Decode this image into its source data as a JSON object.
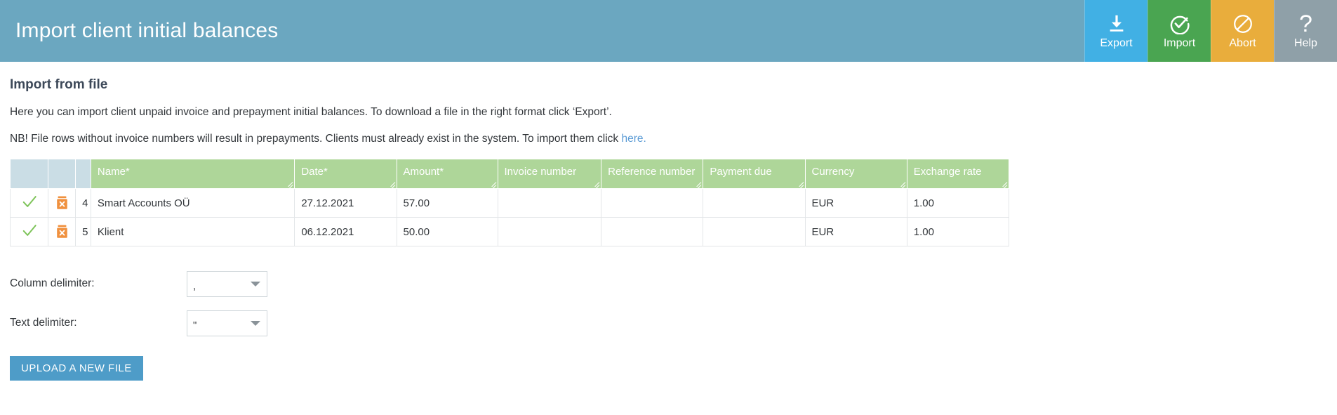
{
  "header": {
    "title": "Import client initial balances",
    "actions": [
      {
        "label": "Export",
        "icon": "download-icon",
        "color": "#41b0e4"
      },
      {
        "label": "Import",
        "icon": "check-circle-icon",
        "color": "#4aa551"
      },
      {
        "label": "Abort",
        "icon": "no-entry-icon",
        "color": "#e9ad3c"
      },
      {
        "label": "Help",
        "icon": "question-mark-icon",
        "color": "#8fa0a8"
      }
    ]
  },
  "main": {
    "section_title": "Import from file",
    "intro": "Here you can import client unpaid invoice and prepayment initial balances. To download a file in the right format click ‘Export’.",
    "note_before_link": "NB! File rows without invoice numbers will result in prepayments. Clients must already exist in the system. To import them click ",
    "note_link": "here.",
    "link_color": "#5b9bd5"
  },
  "table": {
    "header_bg": "#aed699",
    "narrow_header_bg": "#cadde5",
    "columns": [
      "",
      "",
      "",
      "Name*",
      "Date*",
      "Amount*",
      "Invoice number",
      "Reference number",
      "Payment due",
      "Currency",
      "Exchange rate"
    ],
    "rows": [
      {
        "status": "valid",
        "delete_icon": "trash-delete-icon",
        "index": "4",
        "name": "Smart Accounts OÜ",
        "date": "27.12.2021",
        "amount": "57.00",
        "invoice_number": "",
        "reference_number": "",
        "payment_due": "",
        "currency": "EUR",
        "exchange_rate": "1.00"
      },
      {
        "status": "valid",
        "delete_icon": "trash-delete-icon",
        "index": "5",
        "name": "Klient",
        "date": "06.12.2021",
        "amount": "50.00",
        "invoice_number": "",
        "reference_number": "",
        "payment_due": "",
        "currency": "EUR",
        "exchange_rate": "1.00"
      }
    ]
  },
  "form": {
    "column_delimiter_label": "Column delimiter:",
    "column_delimiter_value": ",",
    "text_delimiter_label": "Text delimiter:",
    "text_delimiter_value": "\"",
    "upload_button": "UPLOAD A NEW FILE"
  }
}
